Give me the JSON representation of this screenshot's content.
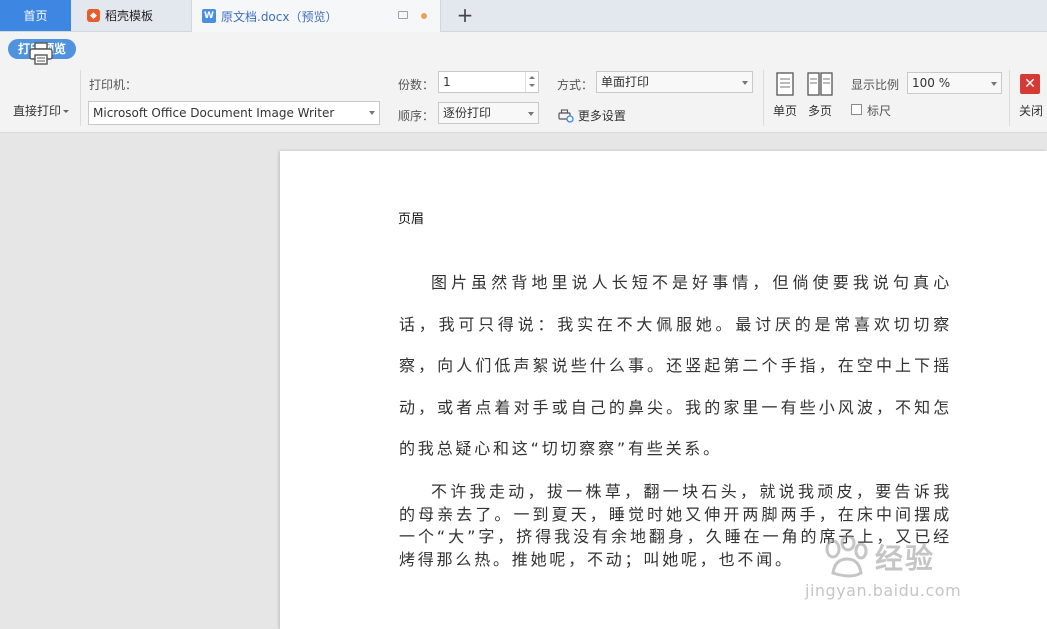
{
  "tabs": {
    "home": "首页",
    "templates": "稻壳模板",
    "document": "原文档.docx（预览）",
    "add": "+"
  },
  "toolbar": {
    "preview_label": "打印预览",
    "direct_print": "直接打印",
    "printer_label": "打印机：",
    "printer_value": "Microsoft Office Document Image Writer",
    "copies_label": "份数：",
    "copies_value": "1",
    "order_label": "顺序：",
    "order_value": "逐份打印",
    "mode_label": "方式：",
    "mode_value": "单面打印",
    "more_settings": "更多设置",
    "single_page": "单页",
    "multi_page": "多页",
    "zoom_label": "显示比例",
    "zoom_value": "100 %",
    "ruler_label": "标尺",
    "ruler_checked": false,
    "close_label": "关闭"
  },
  "document": {
    "header": "页眉",
    "paragraph1": "图片虽然背地里说人长短不是好事情，但倘使要我说句真心话，我可只得说：我实在不大佩服她。最讨厌的是常喜欢切切察察，向人们低声絮说些什么事。还竖起第二个手指，在空中上下摇动，或者点着对手或自己的鼻尖。我的家里一有些小风波，不知怎的我总疑心和这“切切察察”有些关系。",
    "paragraph2": "不许我走动，拔一株草，翻一块石头，就说我顽皮，要告诉我的母亲去了。一到夏天，睡觉时她又伸开两脚两手，在床中间摆成一个“大”字，挤得我没有余地翻身，久睡在一角的席子上，又已经烤得那么热。推她呢，不动；叫她呢，也不闻。"
  },
  "watermark": {
    "brand": "经验",
    "url": "jingyan.baidu.com"
  },
  "colors": {
    "accent": "#3d86e2",
    "close": "#d63a34",
    "template_icon": "#e85b2a"
  }
}
